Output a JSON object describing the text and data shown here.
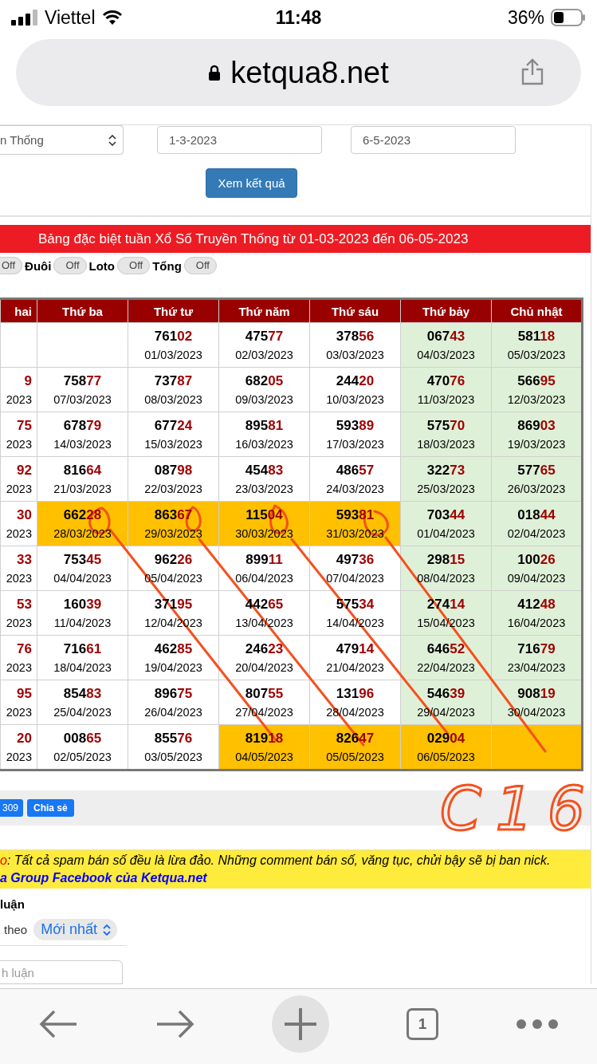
{
  "status_bar": {
    "carrier": "Viettel",
    "time": "11:48",
    "battery": "36%"
  },
  "address_bar": {
    "url": "ketqua8.net"
  },
  "filter": {
    "lottery_select": "n Thống",
    "from_date": "1-3-2023",
    "to_date": "6-5-2023",
    "submit": "Xem kết quả"
  },
  "banner": {
    "title": "Bảng đặc biệt tuần Xổ Số Truyền Thống từ 01-03-2023 đến 06-05-2023"
  },
  "toggles": [
    {
      "state": "Off",
      "on": false
    },
    {
      "label": "Đuôi",
      "state": "Off",
      "on": false
    },
    {
      "label": "Loto",
      "state": "Off",
      "on": false
    },
    {
      "label": "Tổng",
      "state": "Off",
      "on": false
    }
  ],
  "table": {
    "columns": [
      {
        "label": "hai",
        "weekend": false
      },
      {
        "label": "Thứ ba",
        "weekend": false
      },
      {
        "label": "Thứ tư",
        "weekend": false
      },
      {
        "label": "Thứ năm",
        "weekend": false
      },
      {
        "label": "Thứ sáu",
        "weekend": false
      },
      {
        "label": "Thứ bảy",
        "weekend": true
      },
      {
        "label": "Chủ nhật",
        "weekend": true
      }
    ],
    "rows": [
      [
        {
          "highlighted": false
        },
        {
          "highlighted": false
        },
        {
          "number": "76102",
          "date": "01/03/2023",
          "highlighted": false
        },
        {
          "number": "47577",
          "date": "02/03/2023",
          "highlighted": false
        },
        {
          "number": "37856",
          "date": "03/03/2023",
          "highlighted": false
        },
        {
          "number": "06743",
          "date": "04/03/2023",
          "highlighted": false
        },
        {
          "number": "58118",
          "date": "05/03/2023",
          "highlighted": false
        }
      ],
      [
        {
          "number": "9",
          "date": "2023",
          "highlighted": false
        },
        {
          "number": "75877",
          "date": "07/03/2023",
          "highlighted": false
        },
        {
          "number": "73787",
          "date": "08/03/2023",
          "highlighted": false
        },
        {
          "number": "68205",
          "date": "09/03/2023",
          "highlighted": false
        },
        {
          "number": "24420",
          "date": "10/03/2023",
          "highlighted": false
        },
        {
          "number": "47076",
          "date": "11/03/2023",
          "highlighted": false
        },
        {
          "number": "56695",
          "date": "12/03/2023",
          "highlighted": false
        }
      ],
      [
        {
          "number": "75",
          "date": "2023",
          "highlighted": false
        },
        {
          "number": "67879",
          "date": "14/03/2023",
          "highlighted": false
        },
        {
          "number": "67724",
          "date": "15/03/2023",
          "highlighted": false
        },
        {
          "number": "89581",
          "date": "16/03/2023",
          "highlighted": false
        },
        {
          "number": "59389",
          "date": "17/03/2023",
          "highlighted": false
        },
        {
          "number": "57570",
          "date": "18/03/2023",
          "highlighted": false
        },
        {
          "number": "86903",
          "date": "19/03/2023",
          "highlighted": false
        }
      ],
      [
        {
          "number": "92",
          "date": "2023",
          "highlighted": false
        },
        {
          "number": "81664",
          "date": "21/03/2023",
          "highlighted": false
        },
        {
          "number": "08798",
          "date": "22/03/2023",
          "highlighted": false
        },
        {
          "number": "45483",
          "date": "23/03/2023",
          "highlighted": false
        },
        {
          "number": "48657",
          "date": "24/03/2023",
          "highlighted": false
        },
        {
          "number": "32273",
          "date": "25/03/2023",
          "highlighted": false
        },
        {
          "number": "57765",
          "date": "26/03/2023",
          "highlighted": false
        }
      ],
      [
        {
          "number": "30",
          "date": "2023",
          "highlighted": false
        },
        {
          "number": "66228",
          "date": "28/03/2023",
          "highlighted": true
        },
        {
          "number": "86367",
          "date": "29/03/2023",
          "highlighted": true
        },
        {
          "number": "11504",
          "date": "30/03/2023",
          "highlighted": true
        },
        {
          "number": "59381",
          "date": "31/03/2023",
          "highlighted": true
        },
        {
          "number": "70344",
          "date": "01/04/2023",
          "highlighted": false
        },
        {
          "number": "01844",
          "date": "02/04/2023",
          "highlighted": false
        }
      ],
      [
        {
          "number": "33",
          "date": "2023",
          "highlighted": false
        },
        {
          "number": "75345",
          "date": "04/04/2023",
          "highlighted": false
        },
        {
          "number": "96226",
          "date": "05/04/2023",
          "highlighted": false
        },
        {
          "number": "89911",
          "date": "06/04/2023",
          "highlighted": false
        },
        {
          "number": "49736",
          "date": "07/04/2023",
          "highlighted": false
        },
        {
          "number": "29815",
          "date": "08/04/2023",
          "highlighted": false
        },
        {
          "number": "10026",
          "date": "09/04/2023",
          "highlighted": false
        }
      ],
      [
        {
          "number": "53",
          "date": "2023",
          "highlighted": false
        },
        {
          "number": "16039",
          "date": "11/04/2023",
          "highlighted": false
        },
        {
          "number": "37195",
          "date": "12/04/2023",
          "highlighted": false
        },
        {
          "number": "44265",
          "date": "13/04/2023",
          "highlighted": false
        },
        {
          "number": "57534",
          "date": "14/04/2023",
          "highlighted": false
        },
        {
          "number": "27414",
          "date": "15/04/2023",
          "highlighted": false
        },
        {
          "number": "41248",
          "date": "16/04/2023",
          "highlighted": false
        }
      ],
      [
        {
          "number": "76",
          "date": "2023",
          "highlighted": false
        },
        {
          "number": "71661",
          "date": "18/04/2023",
          "highlighted": false
        },
        {
          "number": "46285",
          "date": "19/04/2023",
          "highlighted": false
        },
        {
          "number": "24623",
          "date": "20/04/2023",
          "highlighted": false
        },
        {
          "number": "47914",
          "date": "21/04/2023",
          "highlighted": false
        },
        {
          "number": "64652",
          "date": "22/04/2023",
          "highlighted": false
        },
        {
          "number": "71679",
          "date": "23/04/2023",
          "highlighted": false
        }
      ],
      [
        {
          "number": "95",
          "date": "2023",
          "highlighted": false
        },
        {
          "number": "85483",
          "date": "25/04/2023",
          "highlighted": false
        },
        {
          "number": "89675",
          "date": "26/04/2023",
          "highlighted": false
        },
        {
          "number": "80755",
          "date": "27/04/2023",
          "highlighted": false
        },
        {
          "number": "13196",
          "date": "28/04/2023",
          "highlighted": false
        },
        {
          "number": "54639",
          "date": "29/04/2023",
          "highlighted": false
        },
        {
          "number": "90819",
          "date": "30/04/2023",
          "highlighted": false
        }
      ],
      [
        {
          "number": "20",
          "date": "2023",
          "highlighted": false
        },
        {
          "number": "00865",
          "date": "02/05/2023",
          "highlighted": false
        },
        {
          "number": "85576",
          "date": "03/05/2023",
          "highlighted": false
        },
        {
          "number": "81918",
          "date": "04/05/2023",
          "highlighted": true
        },
        {
          "number": "82647",
          "date": "05/05/2023",
          "highlighted": true
        },
        {
          "number": "02904",
          "date": "06/05/2023",
          "highlighted": true
        },
        {
          "highlighted": true
        }
      ]
    ]
  },
  "annotation": {
    "text": "C16"
  },
  "share_bar": {
    "like_count": "309",
    "share": "Chia sẻ"
  },
  "notice": {
    "lead": "o",
    "text": ": Tất cả spam bán số đều là lừa đảo. Những comment bán số, văng tục, chửi bậy sẽ bị ban nick.",
    "link": "a Group Facebook của Ketqua.net"
  },
  "comments": {
    "heading": "luận",
    "sort_label": "theo",
    "sort_select": "Mới nhất",
    "placeholder": "h luận"
  },
  "toolbar": {
    "tab_count": "1"
  }
}
